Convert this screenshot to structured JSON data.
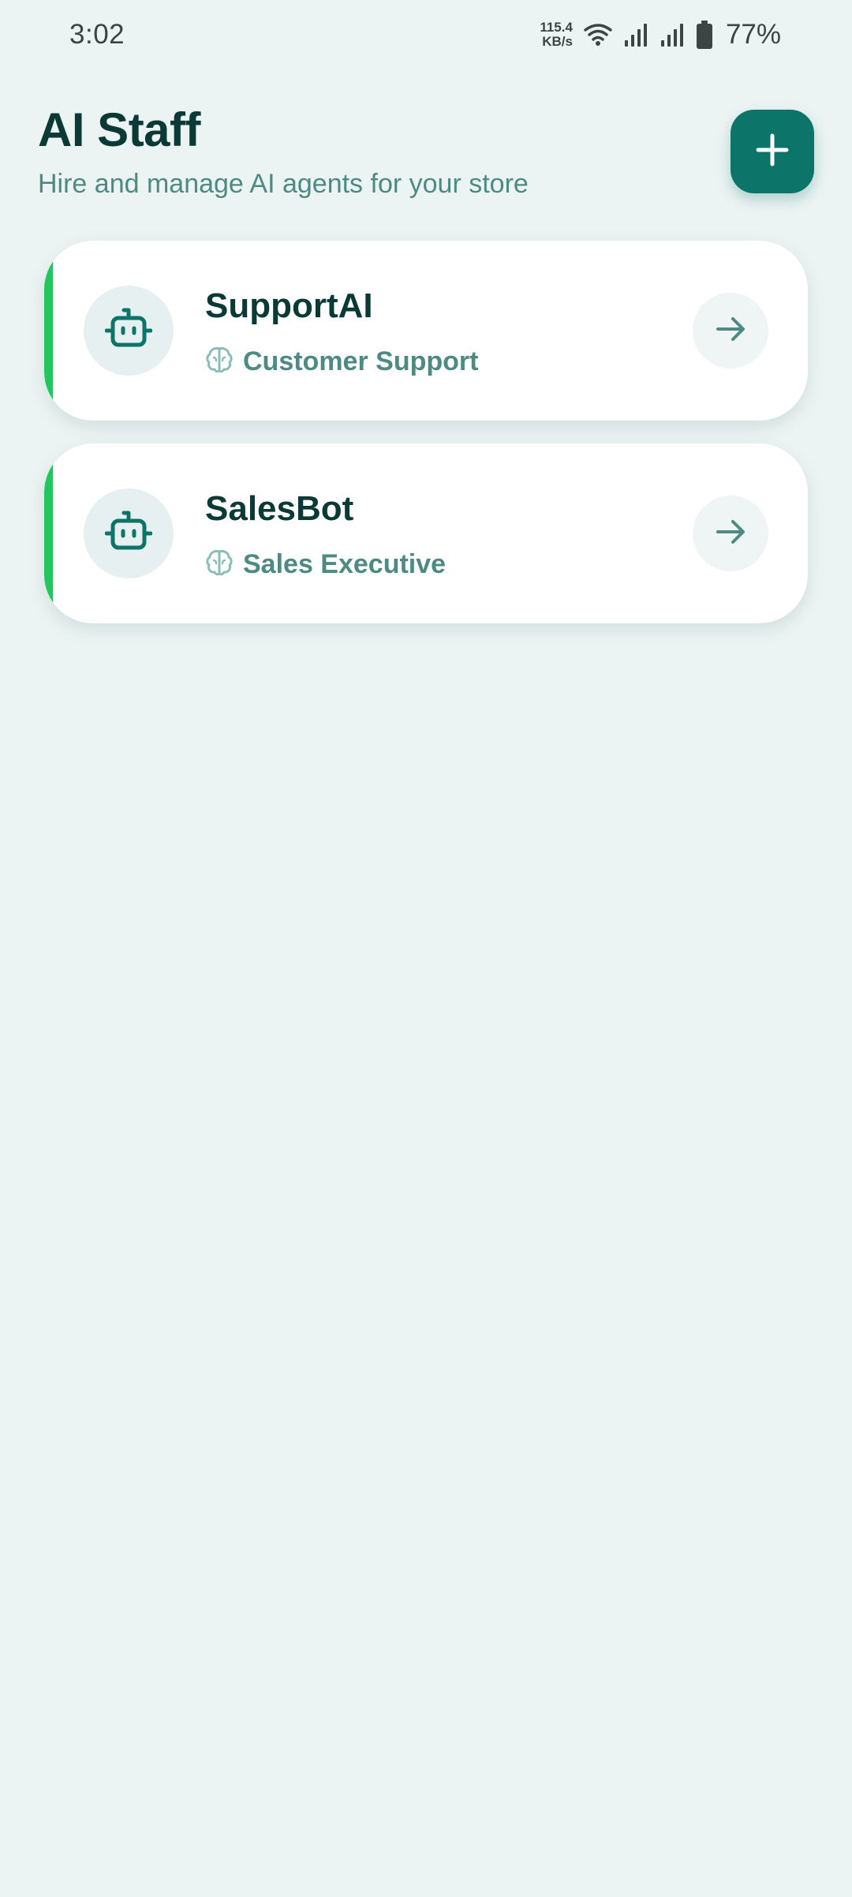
{
  "status_bar": {
    "time": "3:02",
    "net_speed_value": "115.4",
    "net_speed_unit": "KB/s",
    "battery_percent": "77%",
    "icons": [
      "wifi-icon",
      "signal-icon",
      "signal-icon",
      "battery-icon"
    ]
  },
  "header": {
    "title": "AI Staff",
    "subtitle": "Hire and manage AI agents for your store",
    "add_button_icon": "plus-icon"
  },
  "agents": [
    {
      "name": "SupportAI",
      "role": "Customer Support",
      "avatar_icon": "robot-icon",
      "role_icon": "brain-icon",
      "action_icon": "arrow-right-icon"
    },
    {
      "name": "SalesBot",
      "role": "Sales Executive",
      "avatar_icon": "robot-icon",
      "role_icon": "brain-icon",
      "action_icon": "arrow-right-icon"
    }
  ],
  "colors": {
    "background": "#ecf4f3",
    "primary": "#0d746a",
    "title": "#0b3a36",
    "muted": "#4d8a84",
    "accent": "#22c55e"
  }
}
